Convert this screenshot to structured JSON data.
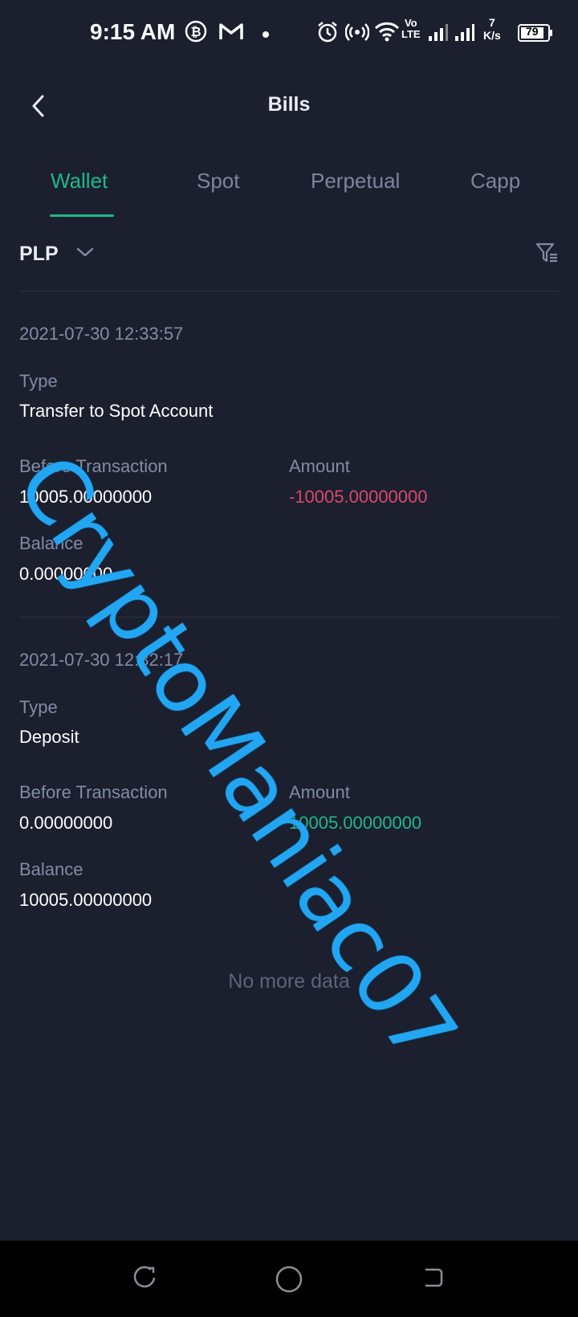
{
  "status": {
    "time": "9:15 AM",
    "network_label_top": "Vo",
    "network_label_bottom": "LTE",
    "speed_top": "7",
    "speed_bottom": "K/s",
    "battery": "79"
  },
  "header": {
    "title": "Bills"
  },
  "tabs": [
    {
      "label": "Wallet",
      "active": true
    },
    {
      "label": "Spot",
      "active": false
    },
    {
      "label": "Perpetual",
      "active": false
    },
    {
      "label": "Capp",
      "active": false
    }
  ],
  "currency": {
    "selected": "PLP"
  },
  "records": [
    {
      "datetime": "2021-07-30 12:33:57",
      "type_label": "Type",
      "type_value": "Transfer to Spot Account",
      "before_label": "Before Transaction",
      "before_value": "10005.00000000",
      "amount_label": "Amount",
      "amount_value": "-10005.00000000",
      "balance_label": "Balance",
      "balance_value": "0.00000000"
    },
    {
      "datetime": "2021-07-30 12:32:17",
      "type_label": "Type",
      "type_value": "Deposit",
      "before_label": "Before Transaction",
      "before_value": "0.00000000",
      "amount_label": "Amount",
      "amount_value": "10005.00000000",
      "balance_label": "Balance",
      "balance_value": "10005.00000000"
    }
  ],
  "footer": {
    "no_more": "No more data"
  },
  "watermark": {
    "text": "CryptoManiac07"
  },
  "colors": {
    "background": "#1b1f2e",
    "accent": "#1fb889",
    "negative": "#d9496d",
    "watermark": "#22a6f2"
  }
}
